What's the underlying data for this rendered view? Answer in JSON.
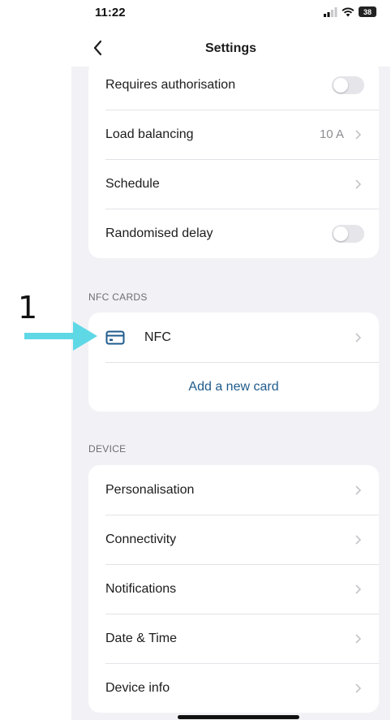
{
  "status_bar": {
    "time": "11:22",
    "battery": "38"
  },
  "nav": {
    "title": "Settings"
  },
  "settings_rows": [
    {
      "label": "Requires authorisation",
      "toggle": false
    },
    {
      "label": "Load balancing",
      "value": "10 A"
    },
    {
      "label": "Schedule"
    },
    {
      "label": "Randomised delay",
      "toggle": false
    }
  ],
  "nfc_section": {
    "header": "NFC CARDS",
    "card_label": "NFC",
    "add_label": "Add a new card"
  },
  "device_section": {
    "header": "DEVICE",
    "items": [
      "Personalisation",
      "Connectivity",
      "Notifications",
      "Date & Time",
      "Device info"
    ]
  },
  "annotation": {
    "number": "1"
  },
  "colors": {
    "arrow": "#5fd8e6",
    "link": "#1f5b8c",
    "background": "#f2f2f6"
  }
}
